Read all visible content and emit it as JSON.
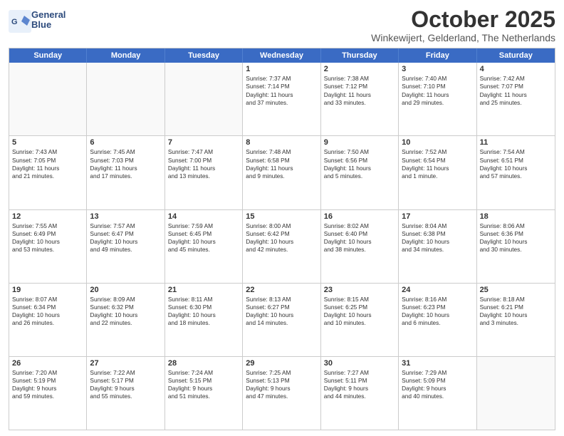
{
  "header": {
    "logo_line1": "General",
    "logo_line2": "Blue",
    "title": "October 2025",
    "subtitle": "Winkewijert, Gelderland, The Netherlands"
  },
  "days_of_week": [
    "Sunday",
    "Monday",
    "Tuesday",
    "Wednesday",
    "Thursday",
    "Friday",
    "Saturday"
  ],
  "weeks": [
    [
      {
        "day": "",
        "lines": [],
        "empty": true
      },
      {
        "day": "",
        "lines": [],
        "empty": true
      },
      {
        "day": "",
        "lines": [],
        "empty": true
      },
      {
        "day": "1",
        "lines": [
          "Sunrise: 7:37 AM",
          "Sunset: 7:14 PM",
          "Daylight: 11 hours",
          "and 37 minutes."
        ],
        "empty": false
      },
      {
        "day": "2",
        "lines": [
          "Sunrise: 7:38 AM",
          "Sunset: 7:12 PM",
          "Daylight: 11 hours",
          "and 33 minutes."
        ],
        "empty": false
      },
      {
        "day": "3",
        "lines": [
          "Sunrise: 7:40 AM",
          "Sunset: 7:10 PM",
          "Daylight: 11 hours",
          "and 29 minutes."
        ],
        "empty": false
      },
      {
        "day": "4",
        "lines": [
          "Sunrise: 7:42 AM",
          "Sunset: 7:07 PM",
          "Daylight: 11 hours",
          "and 25 minutes."
        ],
        "empty": false
      }
    ],
    [
      {
        "day": "5",
        "lines": [
          "Sunrise: 7:43 AM",
          "Sunset: 7:05 PM",
          "Daylight: 11 hours",
          "and 21 minutes."
        ],
        "empty": false
      },
      {
        "day": "6",
        "lines": [
          "Sunrise: 7:45 AM",
          "Sunset: 7:03 PM",
          "Daylight: 11 hours",
          "and 17 minutes."
        ],
        "empty": false
      },
      {
        "day": "7",
        "lines": [
          "Sunrise: 7:47 AM",
          "Sunset: 7:00 PM",
          "Daylight: 11 hours",
          "and 13 minutes."
        ],
        "empty": false
      },
      {
        "day": "8",
        "lines": [
          "Sunrise: 7:48 AM",
          "Sunset: 6:58 PM",
          "Daylight: 11 hours",
          "and 9 minutes."
        ],
        "empty": false
      },
      {
        "day": "9",
        "lines": [
          "Sunrise: 7:50 AM",
          "Sunset: 6:56 PM",
          "Daylight: 11 hours",
          "and 5 minutes."
        ],
        "empty": false
      },
      {
        "day": "10",
        "lines": [
          "Sunrise: 7:52 AM",
          "Sunset: 6:54 PM",
          "Daylight: 11 hours",
          "and 1 minute."
        ],
        "empty": false
      },
      {
        "day": "11",
        "lines": [
          "Sunrise: 7:54 AM",
          "Sunset: 6:51 PM",
          "Daylight: 10 hours",
          "and 57 minutes."
        ],
        "empty": false
      }
    ],
    [
      {
        "day": "12",
        "lines": [
          "Sunrise: 7:55 AM",
          "Sunset: 6:49 PM",
          "Daylight: 10 hours",
          "and 53 minutes."
        ],
        "empty": false
      },
      {
        "day": "13",
        "lines": [
          "Sunrise: 7:57 AM",
          "Sunset: 6:47 PM",
          "Daylight: 10 hours",
          "and 49 minutes."
        ],
        "empty": false
      },
      {
        "day": "14",
        "lines": [
          "Sunrise: 7:59 AM",
          "Sunset: 6:45 PM",
          "Daylight: 10 hours",
          "and 45 minutes."
        ],
        "empty": false
      },
      {
        "day": "15",
        "lines": [
          "Sunrise: 8:00 AM",
          "Sunset: 6:42 PM",
          "Daylight: 10 hours",
          "and 42 minutes."
        ],
        "empty": false
      },
      {
        "day": "16",
        "lines": [
          "Sunrise: 8:02 AM",
          "Sunset: 6:40 PM",
          "Daylight: 10 hours",
          "and 38 minutes."
        ],
        "empty": false
      },
      {
        "day": "17",
        "lines": [
          "Sunrise: 8:04 AM",
          "Sunset: 6:38 PM",
          "Daylight: 10 hours",
          "and 34 minutes."
        ],
        "empty": false
      },
      {
        "day": "18",
        "lines": [
          "Sunrise: 8:06 AM",
          "Sunset: 6:36 PM",
          "Daylight: 10 hours",
          "and 30 minutes."
        ],
        "empty": false
      }
    ],
    [
      {
        "day": "19",
        "lines": [
          "Sunrise: 8:07 AM",
          "Sunset: 6:34 PM",
          "Daylight: 10 hours",
          "and 26 minutes."
        ],
        "empty": false
      },
      {
        "day": "20",
        "lines": [
          "Sunrise: 8:09 AM",
          "Sunset: 6:32 PM",
          "Daylight: 10 hours",
          "and 22 minutes."
        ],
        "empty": false
      },
      {
        "day": "21",
        "lines": [
          "Sunrise: 8:11 AM",
          "Sunset: 6:30 PM",
          "Daylight: 10 hours",
          "and 18 minutes."
        ],
        "empty": false
      },
      {
        "day": "22",
        "lines": [
          "Sunrise: 8:13 AM",
          "Sunset: 6:27 PM",
          "Daylight: 10 hours",
          "and 14 minutes."
        ],
        "empty": false
      },
      {
        "day": "23",
        "lines": [
          "Sunrise: 8:15 AM",
          "Sunset: 6:25 PM",
          "Daylight: 10 hours",
          "and 10 minutes."
        ],
        "empty": false
      },
      {
        "day": "24",
        "lines": [
          "Sunrise: 8:16 AM",
          "Sunset: 6:23 PM",
          "Daylight: 10 hours",
          "and 6 minutes."
        ],
        "empty": false
      },
      {
        "day": "25",
        "lines": [
          "Sunrise: 8:18 AM",
          "Sunset: 6:21 PM",
          "Daylight: 10 hours",
          "and 3 minutes."
        ],
        "empty": false
      }
    ],
    [
      {
        "day": "26",
        "lines": [
          "Sunrise: 7:20 AM",
          "Sunset: 5:19 PM",
          "Daylight: 9 hours",
          "and 59 minutes."
        ],
        "empty": false
      },
      {
        "day": "27",
        "lines": [
          "Sunrise: 7:22 AM",
          "Sunset: 5:17 PM",
          "Daylight: 9 hours",
          "and 55 minutes."
        ],
        "empty": false
      },
      {
        "day": "28",
        "lines": [
          "Sunrise: 7:24 AM",
          "Sunset: 5:15 PM",
          "Daylight: 9 hours",
          "and 51 minutes."
        ],
        "empty": false
      },
      {
        "day": "29",
        "lines": [
          "Sunrise: 7:25 AM",
          "Sunset: 5:13 PM",
          "Daylight: 9 hours",
          "and 47 minutes."
        ],
        "empty": false
      },
      {
        "day": "30",
        "lines": [
          "Sunrise: 7:27 AM",
          "Sunset: 5:11 PM",
          "Daylight: 9 hours",
          "and 44 minutes."
        ],
        "empty": false
      },
      {
        "day": "31",
        "lines": [
          "Sunrise: 7:29 AM",
          "Sunset: 5:09 PM",
          "Daylight: 9 hours",
          "and 40 minutes."
        ],
        "empty": false
      },
      {
        "day": "",
        "lines": [],
        "empty": true
      }
    ]
  ]
}
